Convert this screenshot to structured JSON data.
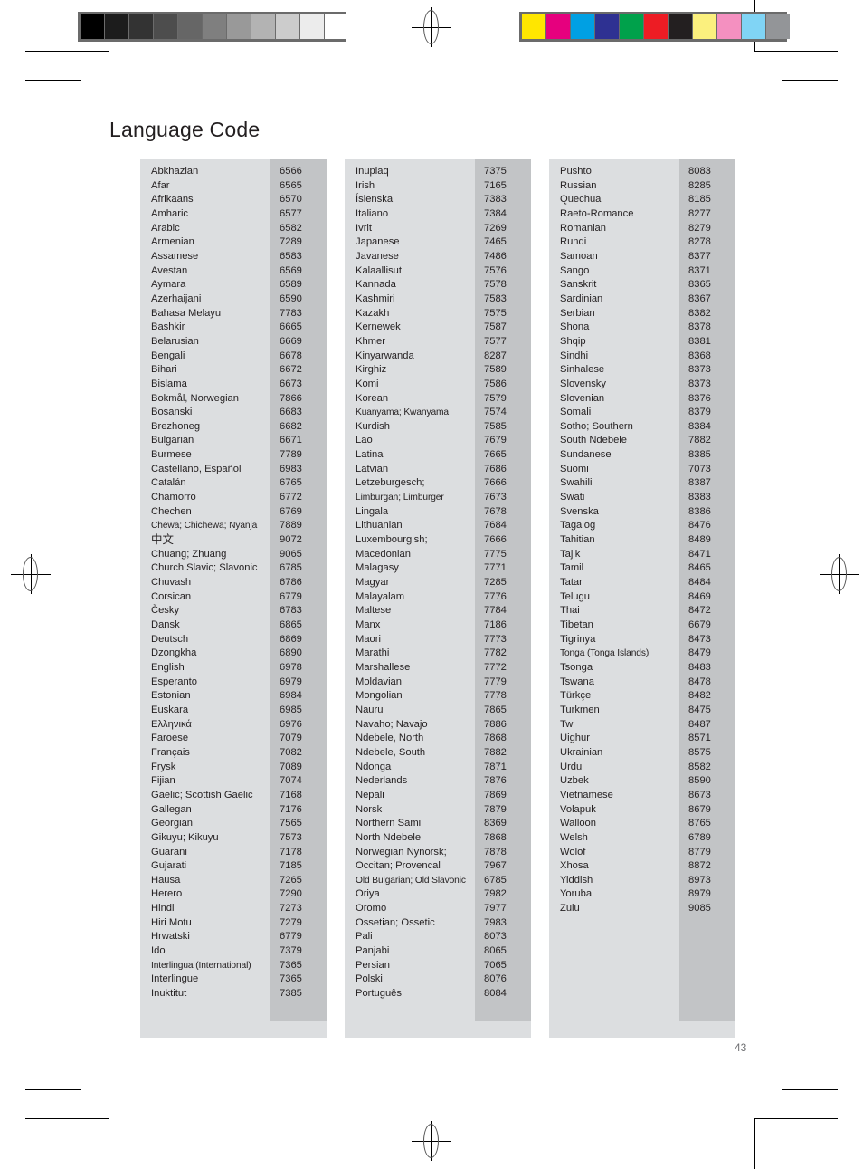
{
  "page": {
    "title": "Language Code",
    "number": "43"
  },
  "colorbars": {
    "grayscale": {
      "name": "grayscale-step-wedge",
      "swatches": [
        "#000000",
        "#1c1c1c",
        "#333333",
        "#4d4d4d",
        "#666666",
        "#7f7f7f",
        "#999999",
        "#b3b3b3",
        "#cccccc",
        "#ececec",
        "#ffffff"
      ]
    },
    "process": {
      "name": "process-color-bar",
      "swatches": [
        "#ffe600",
        "#e6007e",
        "#00a0e3",
        "#2e3192",
        "#00a14b",
        "#ed1c24",
        "#231f20",
        "#fbf07e",
        "#f490c0",
        "#80d4f5",
        "#939598"
      ]
    }
  },
  "table": {
    "columns": [
      {
        "id": "column-1",
        "rows": [
          {
            "name": "Abkhazian",
            "code": "6566"
          },
          {
            "name": "Afar",
            "code": "6565"
          },
          {
            "name": "Afrikaans",
            "code": "6570"
          },
          {
            "name": "Amharic",
            "code": "6577"
          },
          {
            "name": "Arabic",
            "code": "6582"
          },
          {
            "name": "Armenian",
            "code": "7289"
          },
          {
            "name": "Assamese",
            "code": "6583"
          },
          {
            "name": "Avestan",
            "code": "6569"
          },
          {
            "name": "Aymara",
            "code": "6589"
          },
          {
            "name": "Azerhaijani",
            "code": "6590"
          },
          {
            "name": "Bahasa Melayu",
            "code": "7783"
          },
          {
            "name": "Bashkir",
            "code": "6665"
          },
          {
            "name": "Belarusian",
            "code": "6669"
          },
          {
            "name": "Bengali",
            "code": "6678"
          },
          {
            "name": "Bihari",
            "code": "6672"
          },
          {
            "name": "Bislama",
            "code": "6673"
          },
          {
            "name": "Bokmål, Norwegian",
            "code": "7866"
          },
          {
            "name": "Bosanski",
            "code": "6683"
          },
          {
            "name": "Brezhoneg",
            "code": "6682"
          },
          {
            "name": "Bulgarian",
            "code": "6671"
          },
          {
            "name": "Burmese",
            "code": "7789"
          },
          {
            "name": "Castellano, Español",
            "code": "6983"
          },
          {
            "name": "Catalán",
            "code": "6765"
          },
          {
            "name": "Chamorro",
            "code": "6772"
          },
          {
            "name": "Chechen",
            "code": "6769"
          },
          {
            "name": "Chewa; Chichewa; Nyanja",
            "code": "7889",
            "style": "tight"
          },
          {
            "name": "中文",
            "code": "9072",
            "style": "cjk"
          },
          {
            "name": "Chuang; Zhuang",
            "code": "9065"
          },
          {
            "name": "Church Slavic; Slavonic",
            "code": "6785"
          },
          {
            "name": "Chuvash",
            "code": "6786"
          },
          {
            "name": "Corsican",
            "code": "6779"
          },
          {
            "name": "Česky",
            "code": "6783"
          },
          {
            "name": "Dansk",
            "code": "6865"
          },
          {
            "name": "Deutsch",
            "code": "6869"
          },
          {
            "name": "Dzongkha",
            "code": "6890"
          },
          {
            "name": "English",
            "code": "6978"
          },
          {
            "name": "Esperanto",
            "code": "6979"
          },
          {
            "name": "Estonian",
            "code": "6984"
          },
          {
            "name": "Euskara",
            "code": "6985"
          },
          {
            "name": "Ελληνικά",
            "code": "6976"
          },
          {
            "name": "Faroese",
            "code": "7079"
          },
          {
            "name": "Français",
            "code": "7082"
          },
          {
            "name": "Frysk",
            "code": "7089"
          },
          {
            "name": "Fijian",
            "code": "7074"
          },
          {
            "name": "Gaelic; Scottish Gaelic",
            "code": "7168"
          },
          {
            "name": "Gallegan",
            "code": "7176"
          },
          {
            "name": "Georgian",
            "code": "7565"
          },
          {
            "name": "Gikuyu; Kikuyu",
            "code": "7573"
          },
          {
            "name": "Guarani",
            "code": "7178"
          },
          {
            "name": "Gujarati",
            "code": "7185"
          },
          {
            "name": "Hausa",
            "code": "7265"
          },
          {
            "name": "Herero",
            "code": "7290"
          },
          {
            "name": "Hindi",
            "code": "7273"
          },
          {
            "name": "Hiri Motu",
            "code": "7279"
          },
          {
            "name": "Hrwatski",
            "code": "6779"
          },
          {
            "name": "Ido",
            "code": "7379"
          },
          {
            "name": "Interlingua (International)",
            "code": "7365",
            "style": "tight"
          },
          {
            "name": "Interlingue",
            "code": "7365"
          },
          {
            "name": "Inuktitut",
            "code": "7385"
          }
        ]
      },
      {
        "id": "column-2",
        "rows": [
          {
            "name": "Inupiaq",
            "code": "7375"
          },
          {
            "name": "Irish",
            "code": "7165"
          },
          {
            "name": "Íslenska",
            "code": "7383"
          },
          {
            "name": "Italiano",
            "code": "7384"
          },
          {
            "name": "Ivrit",
            "code": "7269"
          },
          {
            "name": "Japanese",
            "code": "7465"
          },
          {
            "name": "Javanese",
            "code": "7486"
          },
          {
            "name": "Kalaallisut",
            "code": "7576"
          },
          {
            "name": "Kannada",
            "code": "7578"
          },
          {
            "name": "Kashmiri",
            "code": "7583"
          },
          {
            "name": "Kazakh",
            "code": "7575"
          },
          {
            "name": "Kernewek",
            "code": "7587"
          },
          {
            "name": "Khmer",
            "code": "7577"
          },
          {
            "name": "Kinyarwanda",
            "code": "8287"
          },
          {
            "name": "Kirghiz",
            "code": "7589"
          },
          {
            "name": "Komi",
            "code": "7586"
          },
          {
            "name": "Korean",
            "code": "7579"
          },
          {
            "name": "Kuanyama; Kwanyama",
            "code": "7574",
            "style": "tight"
          },
          {
            "name": "Kurdish",
            "code": "7585"
          },
          {
            "name": "Lao",
            "code": "7679"
          },
          {
            "name": "Latina",
            "code": "7665"
          },
          {
            "name": "Latvian",
            "code": "7686"
          },
          {
            "name": "Letzeburgesch;",
            "code": "7666"
          },
          {
            "name": "Limburgan; Limburger",
            "code": "7673",
            "style": "tight"
          },
          {
            "name": "Lingala",
            "code": "7678"
          },
          {
            "name": "Lithuanian",
            "code": "7684"
          },
          {
            "name": "Luxembourgish;",
            "code": "7666"
          },
          {
            "name": "Macedonian",
            "code": "7775"
          },
          {
            "name": "Malagasy",
            "code": "7771"
          },
          {
            "name": "Magyar",
            "code": "7285"
          },
          {
            "name": "Malayalam",
            "code": "7776"
          },
          {
            "name": "Maltese",
            "code": "7784"
          },
          {
            "name": "Manx",
            "code": "7186"
          },
          {
            "name": "Maori",
            "code": "7773"
          },
          {
            "name": "Marathi",
            "code": "7782"
          },
          {
            "name": "Marshallese",
            "code": "7772"
          },
          {
            "name": "Moldavian",
            "code": "7779"
          },
          {
            "name": "Mongolian",
            "code": "7778"
          },
          {
            "name": "Nauru",
            "code": "7865"
          },
          {
            "name": "Navaho; Navajo",
            "code": "7886"
          },
          {
            "name": "Ndebele, North",
            "code": "7868"
          },
          {
            "name": "Ndebele, South",
            "code": "7882"
          },
          {
            "name": "Ndonga",
            "code": "7871"
          },
          {
            "name": "Nederlands",
            "code": "7876"
          },
          {
            "name": "Nepali",
            "code": "7869"
          },
          {
            "name": "Norsk",
            "code": "7879"
          },
          {
            "name": "Northern Sami",
            "code": "8369"
          },
          {
            "name": "North Ndebele",
            "code": "7868"
          },
          {
            "name": "Norwegian Nynorsk;",
            "code": "7878"
          },
          {
            "name": "Occitan; Provencal",
            "code": "7967"
          },
          {
            "name": "Old Bulgarian; Old Slavonic",
            "code": "6785",
            "style": "tight"
          },
          {
            "name": "Oriya",
            "code": "7982"
          },
          {
            "name": "Oromo",
            "code": "7977"
          },
          {
            "name": "Ossetian; Ossetic",
            "code": "7983"
          },
          {
            "name": "Pali",
            "code": "8073"
          },
          {
            "name": "Panjabi",
            "code": "8065"
          },
          {
            "name": "Persian",
            "code": "7065"
          },
          {
            "name": "Polski",
            "code": "8076"
          },
          {
            "name": "Português",
            "code": "8084"
          }
        ]
      },
      {
        "id": "column-3",
        "rows": [
          {
            "name": "Pushto",
            "code": "8083"
          },
          {
            "name": "Russian",
            "code": "8285"
          },
          {
            "name": "Quechua",
            "code": "8185"
          },
          {
            "name": "Raeto-Romance",
            "code": "8277"
          },
          {
            "name": "Romanian",
            "code": "8279"
          },
          {
            "name": "Rundi",
            "code": "8278"
          },
          {
            "name": "Samoan",
            "code": "8377"
          },
          {
            "name": "Sango",
            "code": "8371"
          },
          {
            "name": "Sanskrit",
            "code": "8365"
          },
          {
            "name": "Sardinian",
            "code": "8367"
          },
          {
            "name": "Serbian",
            "code": "8382"
          },
          {
            "name": "Shona",
            "code": "8378"
          },
          {
            "name": "Shqip",
            "code": "8381"
          },
          {
            "name": "Sindhi",
            "code": "8368"
          },
          {
            "name": "Sinhalese",
            "code": "8373"
          },
          {
            "name": "Slovensky",
            "code": "8373"
          },
          {
            "name": "Slovenian",
            "code": "8376"
          },
          {
            "name": "Somali",
            "code": "8379"
          },
          {
            "name": "Sotho; Southern",
            "code": "8384"
          },
          {
            "name": "South Ndebele",
            "code": "7882"
          },
          {
            "name": "Sundanese",
            "code": "8385"
          },
          {
            "name": "Suomi",
            "code": "7073"
          },
          {
            "name": "Swahili",
            "code": "8387"
          },
          {
            "name": "Swati",
            "code": "8383"
          },
          {
            "name": "Svenska",
            "code": "8386"
          },
          {
            "name": "Tagalog",
            "code": "8476"
          },
          {
            "name": "Tahitian",
            "code": "8489"
          },
          {
            "name": "Tajik",
            "code": "8471"
          },
          {
            "name": "Tamil",
            "code": "8465"
          },
          {
            "name": "Tatar",
            "code": "8484"
          },
          {
            "name": "Telugu",
            "code": "8469"
          },
          {
            "name": "Thai",
            "code": "8472"
          },
          {
            "name": "Tibetan",
            "code": "6679"
          },
          {
            "name": "Tigrinya",
            "code": "8473"
          },
          {
            "name": "Tonga (Tonga Islands)",
            "code": "8479",
            "style": "tight"
          },
          {
            "name": "Tsonga",
            "code": "8483"
          },
          {
            "name": "Tswana",
            "code": "8478"
          },
          {
            "name": "Türkçe",
            "code": "8482"
          },
          {
            "name": "Turkmen",
            "code": "8475"
          },
          {
            "name": "Twi",
            "code": "8487"
          },
          {
            "name": "Uighur",
            "code": "8571"
          },
          {
            "name": "Ukrainian",
            "code": "8575"
          },
          {
            "name": "Urdu",
            "code": "8582"
          },
          {
            "name": "Uzbek",
            "code": "8590"
          },
          {
            "name": "Vietnamese",
            "code": "8673"
          },
          {
            "name": "Volapuk",
            "code": "8679"
          },
          {
            "name": "Walloon",
            "code": "8765"
          },
          {
            "name": "Welsh",
            "code": "6789"
          },
          {
            "name": "Wolof",
            "code": "8779"
          },
          {
            "name": "Xhosa",
            "code": "8872"
          },
          {
            "name": "Yiddish",
            "code": "8973"
          },
          {
            "name": "Yoruba",
            "code": "8979"
          },
          {
            "name": "Zulu",
            "code": "9085"
          }
        ]
      }
    ]
  }
}
